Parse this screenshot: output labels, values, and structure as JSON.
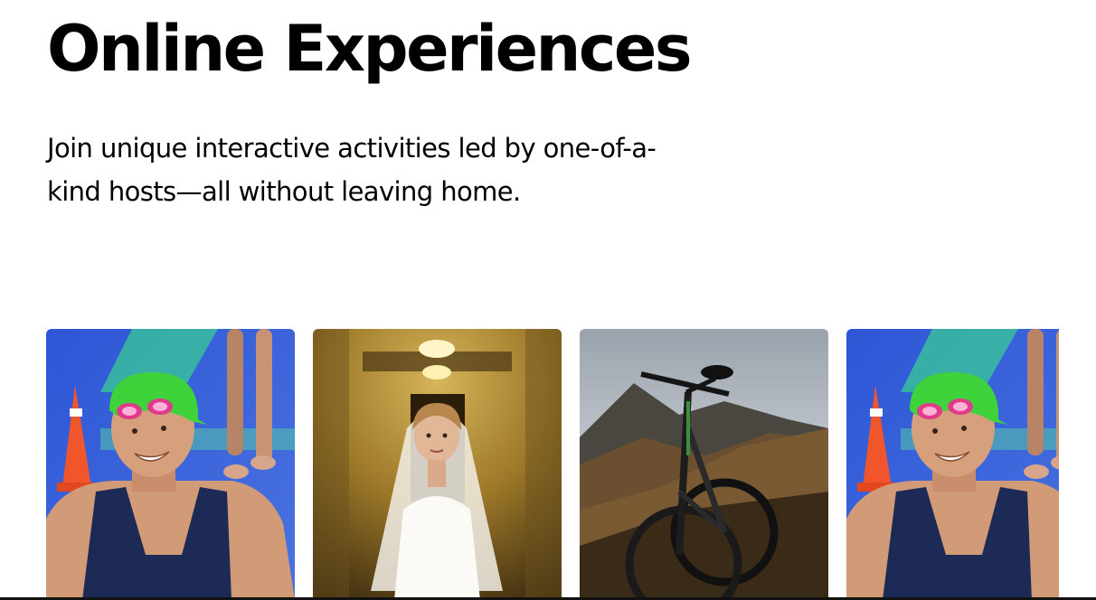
{
  "hero": {
    "title": "Online Experiences",
    "subtitle": "Join unique interactive activities led by one-of-a-kind hosts—all without leaving home."
  },
  "cards": [
    {
      "photo": "triathlete-photo"
    },
    {
      "photo": "bride-photo"
    },
    {
      "photo": "mountain-bike-photo"
    },
    {
      "photo": "triathlete-photo"
    }
  ],
  "colors": {
    "text": "#000000",
    "background": "#ffffff",
    "pool_blue": "#3b62d8",
    "cap_green": "#3ed33a",
    "swimsuit_navy": "#1d2a55",
    "hall_gold": "#a07a2a",
    "sky_grey": "#cfd3d8"
  }
}
